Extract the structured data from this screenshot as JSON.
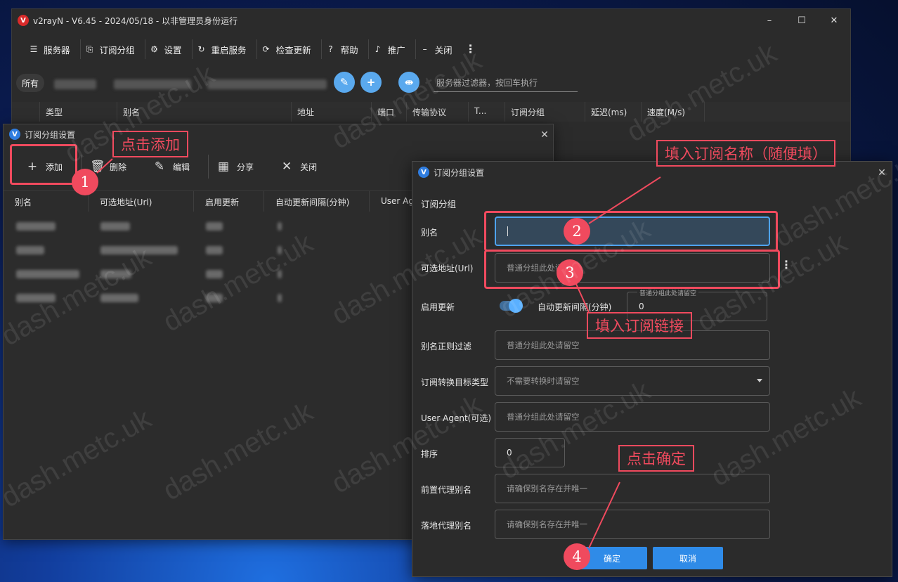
{
  "app": {
    "title": "v2rayN - V6.45 - 2024/05/18 - 以非管理员身份运行",
    "icon_letter": "V"
  },
  "toolbar": {
    "items": [
      {
        "label": "服务器",
        "icon": "server-icon"
      },
      {
        "label": "订阅分组",
        "icon": "subscription-icon"
      },
      {
        "label": "设置",
        "icon": "gear-icon"
      },
      {
        "label": "重启服务",
        "icon": "restart-icon"
      },
      {
        "label": "检查更新",
        "icon": "update-icon"
      },
      {
        "label": "帮助",
        "icon": "help-icon"
      },
      {
        "label": "推广",
        "icon": "speaker-icon"
      },
      {
        "label": "关闭",
        "icon": "minus-icon"
      }
    ]
  },
  "filter": {
    "all_label": "所有",
    "placeholder": "服务器过滤器，按回车执行"
  },
  "main_table": {
    "columns": [
      "类型",
      "别名",
      "地址",
      "端口",
      "传输协议",
      "T...",
      "订阅分组",
      "延迟(ms)",
      "速度(M/s)"
    ]
  },
  "sub_list_dialog": {
    "title": "订阅分组设置",
    "toolbar": [
      {
        "label": "添加",
        "icon": "plus-icon"
      },
      {
        "label": "删除",
        "icon": "trash-icon"
      },
      {
        "label": "编辑",
        "icon": "pencil-icon"
      },
      {
        "label": "分享",
        "icon": "qr-icon"
      },
      {
        "label": "关闭",
        "icon": "close-icon"
      }
    ],
    "columns": [
      "别名",
      "可选地址(Url)",
      "启用更新",
      "自动更新间隔(分钟)",
      "User Agent"
    ]
  },
  "edit_dialog": {
    "title": "订阅分组设置",
    "section": "订阅分组",
    "fields": {
      "alias": {
        "label": "别名",
        "value": ""
      },
      "url": {
        "label": "可选地址(Url)",
        "placeholder": "普通分组此处请留空"
      },
      "enable_update": {
        "label": "启用更新",
        "on": true
      },
      "update_interval": {
        "label": "自动更新间隔(分钟)",
        "float_label": "普通分组此处请留空",
        "value": "0"
      },
      "alias_filter": {
        "label": "别名正则过滤",
        "placeholder": "普通分组此处请留空"
      },
      "convert_target": {
        "label": "订阅转换目标类型",
        "placeholder": "不需要转换时请留空"
      },
      "user_agent": {
        "label": "User Agent(可选)",
        "placeholder": "普通分组此处请留空"
      },
      "sort": {
        "label": "排序",
        "value": "0"
      },
      "prev_proxy": {
        "label": "前置代理别名",
        "placeholder": "请确保别名存在并唯一"
      },
      "next_proxy": {
        "label": "落地代理别名",
        "placeholder": "请确保别名存在并唯一"
      }
    },
    "ok_label": "确定",
    "cancel_label": "取消"
  },
  "annotations": {
    "step1": {
      "number": "1",
      "text": "点击添加"
    },
    "step2": {
      "number": "2",
      "text": "填入订阅名称（随便填）"
    },
    "step3": {
      "number": "3",
      "text": "填入订阅链接"
    },
    "step4": {
      "number": "4",
      "text": "点击确定"
    },
    "color": "#f04a5e"
  },
  "watermark": "dash.metc.uk",
  "colors": {
    "accent": "#2f8be8",
    "round_button": "#5aa9ee",
    "annotation": "#f04a5e"
  }
}
